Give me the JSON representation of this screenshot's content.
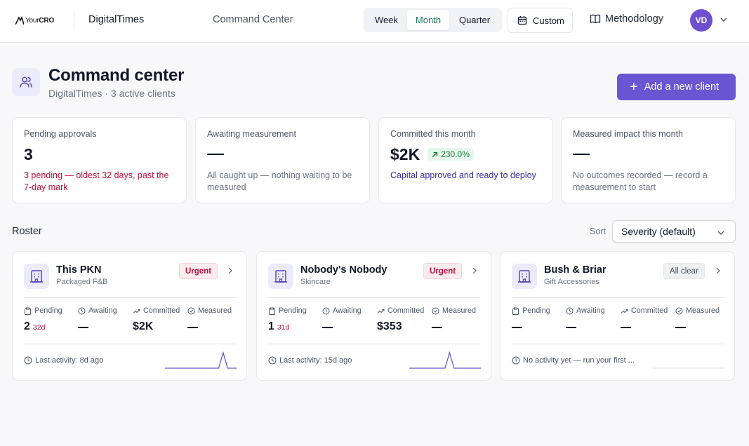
{
  "header": {
    "logo_text_prefix": "Your",
    "logo_text_suffix": "CRO",
    "org_name": "DigitalTimes",
    "nav_title": "Command Center",
    "period_tabs": [
      {
        "label": "Week",
        "active": false
      },
      {
        "label": "Month",
        "active": true
      },
      {
        "label": "Quarter",
        "active": false
      }
    ],
    "custom_label": "Custom",
    "methodology_label": "Methodology",
    "avatar_initials": "VD",
    "accent_color": "#6a55d2"
  },
  "page": {
    "title": "Command center",
    "subtitle": "DigitalTimes · 3 active clients",
    "add_client_label": "Add a new client"
  },
  "stats": [
    {
      "label": "Pending approvals",
      "value": "3",
      "note": "3 pending — oldest 32 days, past the 7-day mark",
      "tone": "red"
    },
    {
      "label": "Awaiting measurement",
      "value": "",
      "note": "All caught up — nothing waiting to be measured",
      "tone": "gray"
    },
    {
      "label": "Committed this month",
      "value": "$2K",
      "change": "230.0%",
      "note": "Capital approved and ready to deploy",
      "tone": "indigo"
    },
    {
      "label": "Measured impact this month",
      "value": "",
      "note": "No outcomes recorded — record a measurement to start",
      "tone": "gray"
    }
  ],
  "roster": {
    "title": "Roster",
    "sort_label": "Sort",
    "sort_value": "Severity (default)",
    "metric_labels": {
      "pending": "Pending",
      "awaiting": "Awaiting",
      "committed": "Committed",
      "measured": "Measured"
    },
    "clients": [
      {
        "name": "This PKN",
        "category": "Packaged F&B",
        "status": "Urgent",
        "pending": "2",
        "pending_age": "32d",
        "awaiting": "",
        "committed": "$2K",
        "measured": "",
        "activity": "Last activity: 8d ago",
        "spark": [
          0,
          0,
          0,
          0,
          0,
          0,
          0,
          0,
          0,
          0,
          0,
          0,
          0,
          1,
          0,
          0,
          0
        ]
      },
      {
        "name": "Nobody's Nobody",
        "category": "Skincare",
        "status": "Urgent",
        "pending": "1",
        "pending_age": "31d",
        "awaiting": "",
        "committed": "$353",
        "measured": "",
        "activity": "Last activity: 15d ago",
        "spark": [
          0,
          0,
          0,
          0,
          0,
          0,
          0,
          0,
          0,
          1,
          0,
          0,
          0,
          0,
          0,
          0,
          0
        ]
      },
      {
        "name": "Bush & Briar",
        "category": "Gift Accessories",
        "status": "All clear",
        "pending": "",
        "pending_age": "",
        "awaiting": "",
        "committed": "",
        "measured": "",
        "activity": "No activity yet — run your first ...",
        "spark": []
      }
    ]
  }
}
